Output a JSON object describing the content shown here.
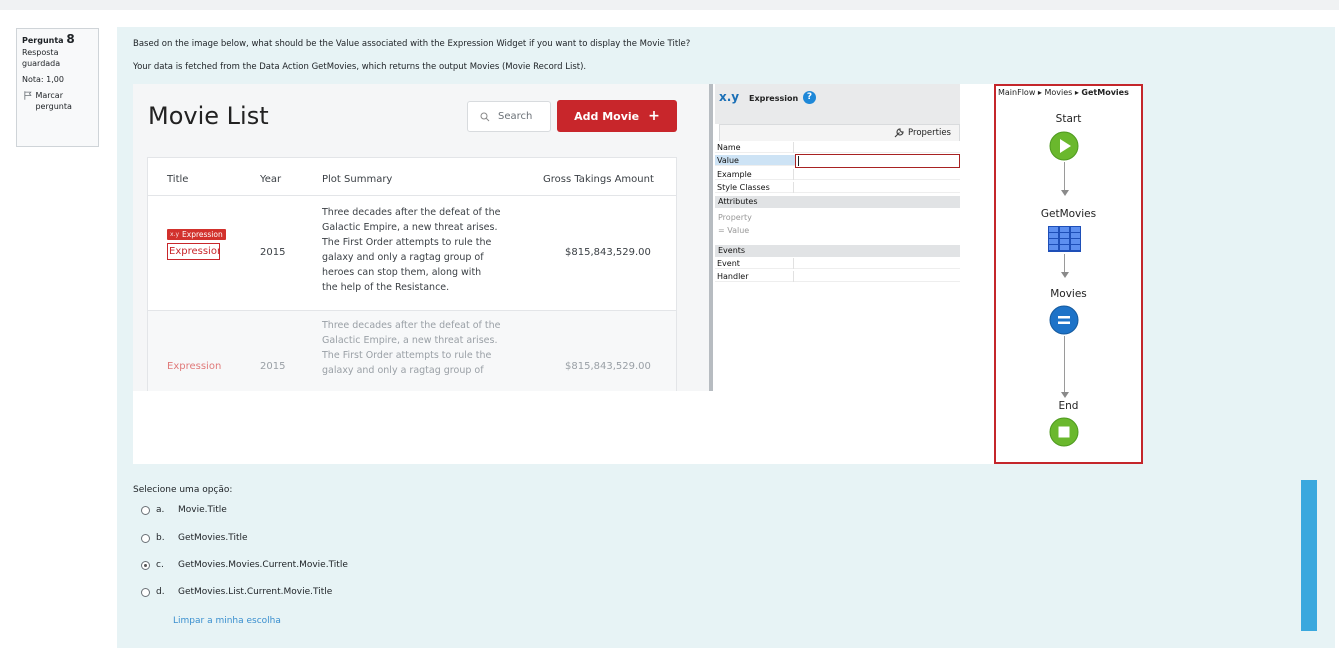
{
  "info": {
    "question_label": "Pergunta",
    "question_number": "8",
    "state": "Resposta guardada",
    "grade": "Nota: 1,00",
    "flag_label": "Marcar pergunta"
  },
  "question": {
    "line1": "Based on the image below, what should be the Value associated with the Expression Widget if you want to display the Movie Title?",
    "line2": "Your data is fetched from the Data Action GetMovies, which returns the output Movies (Movie Record List)."
  },
  "movie_app": {
    "title": "Movie List",
    "search_placeholder": "Search",
    "add_button": "Add Movie",
    "columns": [
      "Title",
      "Year",
      "Plot Summary",
      "Gross Takings Amount"
    ],
    "tag_label": "Expression",
    "tag_prefix": "x.y",
    "rows": [
      {
        "title": "Expression",
        "year": "2015",
        "plot": [
          "Three decades after the defeat of the",
          "Galactic Empire, a new threat arises.",
          "The First Order attempts to rule the",
          "galaxy and only a ragtag group of",
          "heroes can stop them, along with",
          "the help of the Resistance."
        ],
        "gross": "$815,843,529.00"
      },
      {
        "title": "Expression",
        "year": "2015",
        "plot": [
          "Three decades after the defeat of the",
          "Galactic Empire, a new threat arises.",
          "The First Order attempts to rule the",
          "galaxy and only a ragtag group of"
        ],
        "gross": "$815,843,529.00"
      }
    ]
  },
  "properties": {
    "widget_icon": "x.y",
    "widget_name": "Expression",
    "tab": "Properties",
    "rows": [
      "Name",
      "Value",
      "Example",
      "Style Classes"
    ],
    "attributes_section": "Attributes",
    "property_label": "Property",
    "value_label": "= Value",
    "events_section": "Events",
    "events_rows": [
      "Event",
      "Handler"
    ]
  },
  "flow": {
    "breadcrumb": [
      "MainFlow",
      "Movies",
      "GetMovies"
    ],
    "nodes": [
      "Start",
      "GetMovies",
      "Movies",
      "End"
    ]
  },
  "answers": {
    "prompt": "Selecione uma opção:",
    "options": [
      {
        "letter": "a.",
        "text": "Movie.Title"
      },
      {
        "letter": "b.",
        "text": "GetMovies.Title"
      },
      {
        "letter": "c.",
        "text": "GetMovies.Movies.Current.Movie.Title"
      },
      {
        "letter": "d.",
        "text": "GetMovies.List.Current.Movie.Title"
      }
    ],
    "selected": "c.",
    "clear_link": "Limpar a minha escolha"
  },
  "colors": {
    "accent_red": "#c8262b",
    "content_bg": "#e7f3f5",
    "link_blue": "#3a8fcf",
    "start_green": "#6ab82d",
    "aggregate_blue": "#1e73c8"
  }
}
